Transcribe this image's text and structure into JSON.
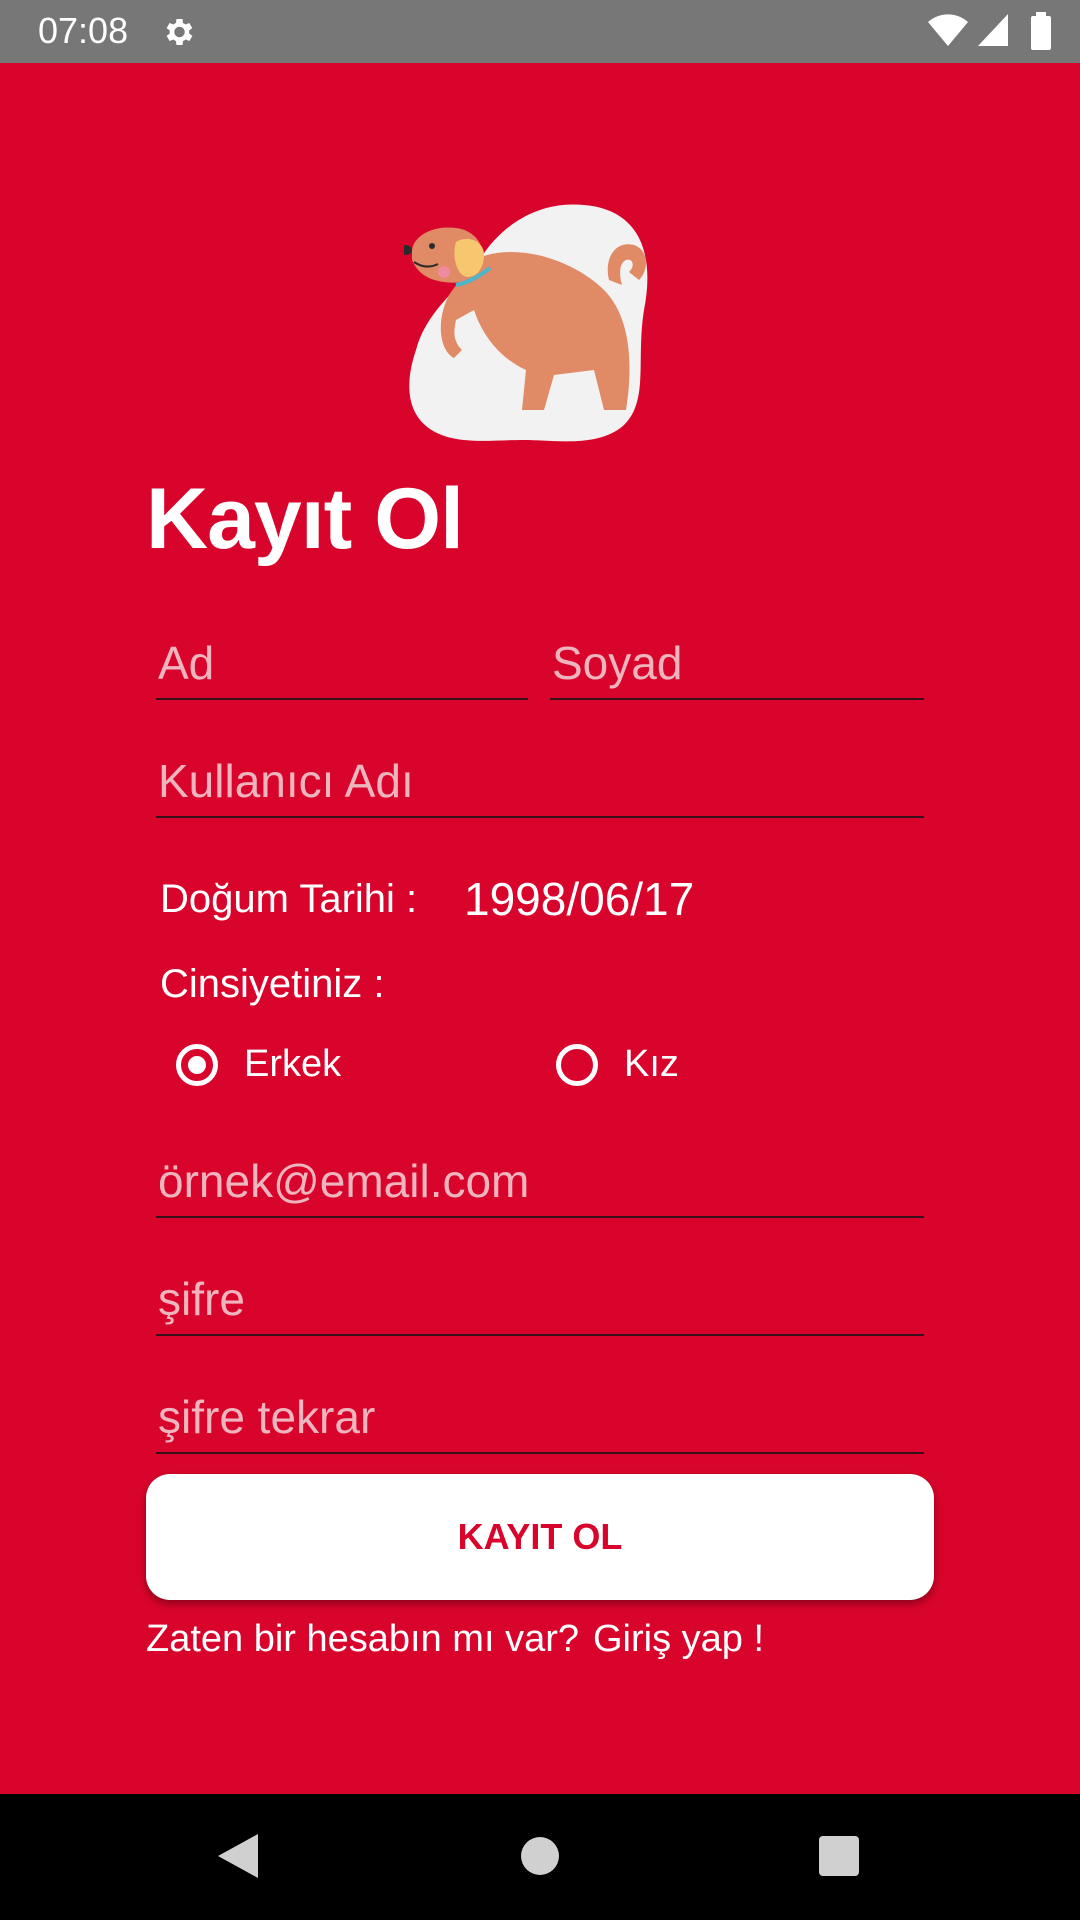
{
  "status_bar": {
    "time": "07:08"
  },
  "form": {
    "title": "Kayıt Ol",
    "first_name_placeholder": "Ad",
    "last_name_placeholder": "Soyad",
    "username_placeholder": "Kullanıcı Adı",
    "birth_date_label": "Doğum Tarihi :",
    "birth_date_value": "1998/06/17",
    "gender_label": "Cinsiyetiniz :",
    "gender_options": [
      "Erkek",
      "Kız"
    ],
    "gender_selected": "Erkek",
    "email_placeholder": "örnek@email.com",
    "password_placeholder": "şifre",
    "password_repeat_placeholder": "şifre tekrar",
    "submit_label": "KAYIT OL",
    "have_account_text": "Zaten bir hesabın mı var?",
    "login_link": "Giriş yap !"
  },
  "colors": {
    "background": "#d9042b",
    "status_bar": "#777777",
    "button_bg": "#ffffff",
    "button_text": "#d9042b"
  },
  "icons": [
    "gear-icon",
    "wifi-icon",
    "signal-icon",
    "battery-icon",
    "back-icon",
    "home-icon",
    "recents-icon"
  ]
}
